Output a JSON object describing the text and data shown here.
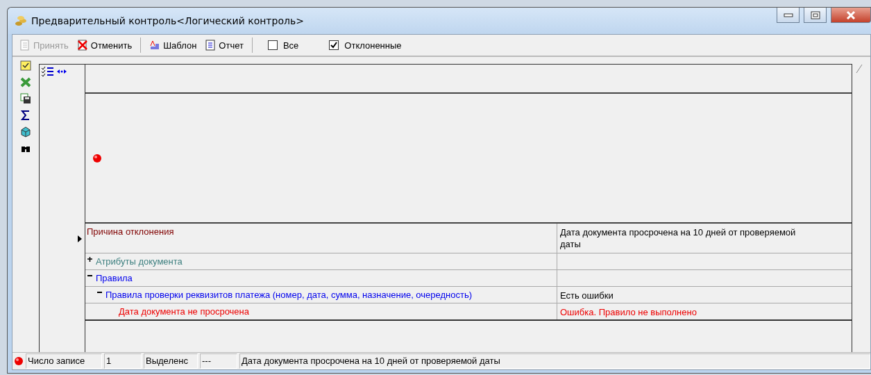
{
  "window": {
    "title": "Предварительный контроль<Логический контроль>"
  },
  "toolbar": {
    "buttons": [
      {
        "label": "Принять",
        "disabled": true
      },
      {
        "label": "Отменить",
        "disabled": false
      },
      {
        "label": "Шаблон",
        "disabled": false
      },
      {
        "label": "Отчет",
        "disabled": false
      }
    ],
    "checkboxes": [
      {
        "label": "Все",
        "checked": false
      },
      {
        "label": "Отклоненные",
        "checked": true
      }
    ]
  },
  "tree": [
    {
      "kind": "reason",
      "label": "Причина отклонения",
      "value": "Дата документа просрочена на 10 дней от проверяемой даты",
      "current": true
    },
    {
      "kind": "group",
      "label": "Атрибуты документа",
      "expanded": false,
      "current": false
    },
    {
      "kind": "rules",
      "label": "Правила",
      "expanded": true,
      "current": false,
      "children": [
        {
          "kind": "rule",
          "label": "Правила проверки реквизитов платежа (номер, дата, сумма, назначение, очередность)",
          "value": "Есть ошибки",
          "expanded": true,
          "current": false,
          "children": [
            {
              "kind": "check",
              "label": "Дата документа не просрочена",
              "value": "Ошибка. Правило не выполнено",
              "current": false
            }
          ]
        }
      ]
    }
  ],
  "status_bar": {
    "records_label": "Число записе",
    "records": "1",
    "selected_label": "Выделенс",
    "selected": "---",
    "message": "Дата документа просрочена на 10 дней от проверяемой даты"
  }
}
